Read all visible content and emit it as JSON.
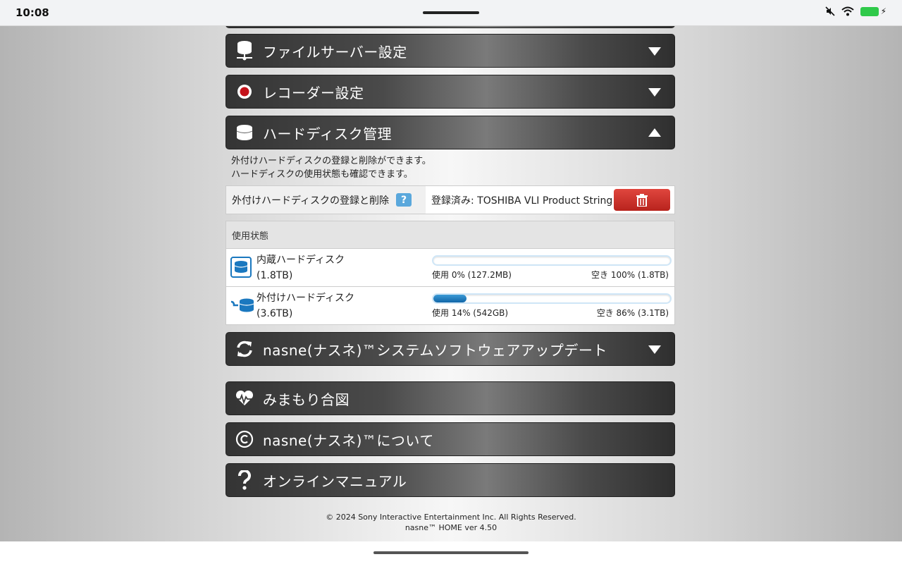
{
  "status_bar": {
    "time": "10:08"
  },
  "sections": {
    "file_server": {
      "title": "ファイルサーバー設定",
      "icon": "server-icon"
    },
    "recorder": {
      "title": "レコーダー設定",
      "icon": "record-icon"
    },
    "hdd": {
      "title": "ハードディスク管理",
      "icon": "disk-icon",
      "desc_line1": "外付けハードディスクの登録と削除ができます。",
      "desc_line2": "ハードディスクの使用状態も確認できます。",
      "register_label": "外付けハードディスクの登録と削除",
      "help": "?",
      "registered": "登録済み: TOSHIBA VLI Product String",
      "usage_header": "使用状態",
      "disks": [
        {
          "name": "内蔵ハードディスク",
          "capacity": "(1.8TB)",
          "used_text": "使用 0% (127.2MB)",
          "free_text": "空き 100% (1.8TB)",
          "used_percent": 0
        },
        {
          "name": "外付けハードディスク",
          "capacity": "(3.6TB)",
          "used_text": "使用 14% (542GB)",
          "free_text": "空き 86% (3.1TB)",
          "used_percent": 14
        }
      ]
    },
    "update": {
      "title": "nasne(ナスネ)™システムソフトウェアアップデート",
      "icon": "refresh-icon"
    },
    "mimamori": {
      "title": "みまもり合図",
      "icon": "heartbeat-icon"
    },
    "about": {
      "title": "nasne(ナスネ)™について",
      "icon": "copyright-icon"
    },
    "manual": {
      "title": "オンラインマニュアル",
      "icon": "question-icon"
    }
  },
  "footer": {
    "copyright": "© 2024 Sony Interactive Entertainment Inc. All Rights Reserved.",
    "version": "nasne™ HOME ver 4.50"
  },
  "colors": {
    "delete_button": "#d0322b",
    "progress": "#1a78bf",
    "icon_blue": "#1a78bf"
  }
}
